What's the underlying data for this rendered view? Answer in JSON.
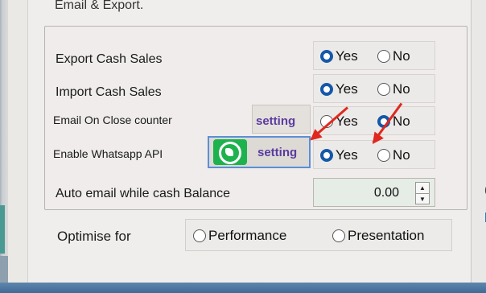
{
  "group": {
    "title": "Email & Export."
  },
  "rows": [
    {
      "label": "Export Cash Sales",
      "yes": "Yes",
      "no": "No",
      "selected": "yes"
    },
    {
      "label": "Import Cash Sales",
      "yes": "Yes",
      "no": "No",
      "selected": "yes"
    },
    {
      "label": "Email On Close counter",
      "setting": "setting",
      "yes": "Yes",
      "no": "No",
      "selected": "no"
    },
    {
      "label": "Enable Whatsapp API",
      "setting": "setting",
      "yes": "Yes",
      "no": "No",
      "selected": "yes"
    }
  ],
  "auto_email": {
    "label": "Auto email while cash Balance",
    "value": "0.00"
  },
  "optimise": {
    "label": "Optimise for",
    "options": [
      "Performance",
      "Presentation"
    ]
  },
  "icons": {
    "whatsapp": "whatsapp-icon",
    "spinner_up": "chevron-up-icon",
    "spinner_down": "chevron-down-icon",
    "annotation": "red-arrow"
  },
  "colors": {
    "radio_selected": "#1658a8",
    "setting_text": "#5b3aa0",
    "whatsapp_green": "#1eb24f",
    "arrow_red": "#e0281e"
  }
}
